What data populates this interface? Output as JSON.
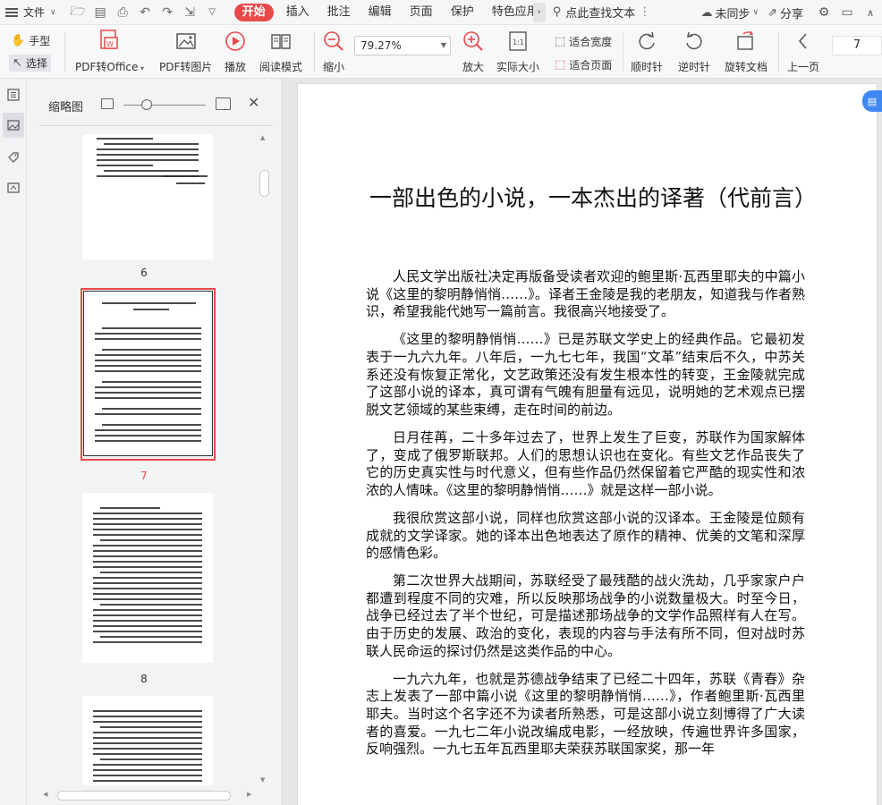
{
  "menubar": {
    "file_label": "文件",
    "tabs": [
      "开始",
      "插入",
      "批注",
      "编辑",
      "页面",
      "保护",
      "特色应用"
    ],
    "active_tab": "开始",
    "search_label": "点此查找文本",
    "sync_label": "未同步",
    "share_label": "分享"
  },
  "ribbon": {
    "hand_label": "手型",
    "select_label": "选择",
    "pdf_office_label": "PDF转Office",
    "pdf_image_label": "PDF转图片",
    "play_label": "播放",
    "read_mode_label": "阅读模式",
    "zoom_out_label": "缩小",
    "zoom_value": "79.27%",
    "zoom_in_label": "放大",
    "actual_size_label": "实际大小",
    "fit_width_label": "适合宽度",
    "fit_page_label": "适合页面",
    "rotate_cw_label": "顺时针",
    "rotate_ccw_label": "逆时针",
    "rotate_doc_label": "旋转文档",
    "prev_page_label": "上一页",
    "page_number": "7"
  },
  "thumbnail_panel": {
    "title": "缩略图",
    "pages": [
      {
        "number": "6",
        "selected": false
      },
      {
        "number": "7",
        "selected": true
      },
      {
        "number": "8",
        "selected": false
      }
    ]
  },
  "document": {
    "title": "一部出色的小说，一本杰出的译著（代前言）",
    "paragraphs": [
      "人民文学出版社决定再版备受读者欢迎的鲍里斯·瓦西里耶夫的中篇小说《这里的黎明静悄悄……》。译者王金陵是我的老朋友，知道我与作者熟识，希望我能代她写一篇前言。我很高兴地接受了。",
      "《这里的黎明静悄悄……》已是苏联文学史上的经典作品。它最初发表于一九六九年。八年后，一九七七年，我国“文革”结束后不久，中苏关系还没有恢复正常化，文艺政策还没有发生根本性的转变，王金陵就完成了这部小说的译本，真可谓有气魄有胆量有远见，说明她的艺术观点已摆脱文艺领域的某些束缚，走在时间的前边。",
      "日月荏苒，二十多年过去了，世界上发生了巨变，苏联作为国家解体了，变成了俄罗斯联邦。人们的思想认识也在变化。有些文艺作品丧失了它的历史真实性与时代意义，但有些作品仍然保留着它严酷的现实性和浓浓的人情味。《这里的黎明静悄悄……》就是这样一部小说。",
      "我很欣赏这部小说，同样也欣赏这部小说的汉译本。王金陵是位颇有成就的文学译家。她的译本出色地表达了原作的精神、优美的文笔和深厚的感情色彩。",
      "第二次世界大战期间，苏联经受了最残酷的战火洗劫，几乎家家户户都遭到程度不同的灾难，所以反映那场战争的小说数量极大。时至今日，战争已经过去了半个世纪，可是描述那场战争的文学作品照样有人在写。由于历史的发展、政治的变化，表现的内容与手法有所不同，但对战时苏联人民命运的探讨仍然是这类作品的中心。",
      "一九六九年，也就是苏德战争结束了已经二十四年，苏联《青春》杂志上发表了一部中篇小说《这里的黎明静悄悄……》，作者鲍里斯·瓦西里耶夫。当时这个名字还不为读者所熟悉，可是这部小说立刻博得了广大读者的喜爱。一九七二年小说改编成电影，一经放映，传遍世界许多国家，反响强烈。一九七五年瓦西里耶夫荣获苏联国家奖，那一年"
    ]
  },
  "colors": {
    "accent": "#e8494a",
    "ribbon_bg": "#f7f8f9",
    "panel_bg": "#f2f3f5",
    "doc_bg": "#e6e7e9",
    "badge": "#3f88f2"
  }
}
